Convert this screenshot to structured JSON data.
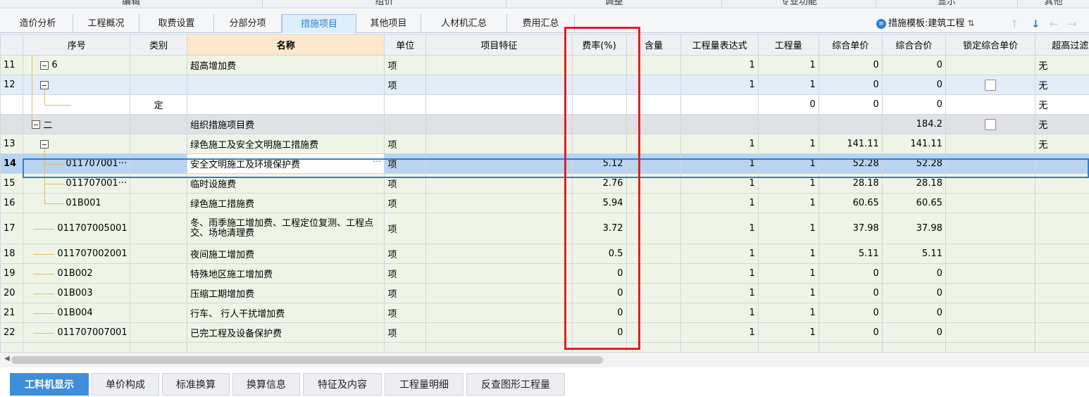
{
  "groups": [
    "编辑",
    "组价",
    "调整",
    "专业功能",
    "显示",
    "其他"
  ],
  "tabs": [
    {
      "label": "造价分析"
    },
    {
      "label": "工程概况"
    },
    {
      "label": "取费设置"
    },
    {
      "label": "分部分项"
    },
    {
      "label": "措施项目",
      "active": true
    },
    {
      "label": "其他项目"
    },
    {
      "label": "人材机汇总"
    },
    {
      "label": "费用汇总"
    }
  ],
  "template": {
    "label": "措施模板:建筑工程",
    "icon": "list-icon",
    "sort_icon": "sort-icon"
  },
  "nav_arrows": {
    "up": "↑",
    "down": "↓",
    "left": "←",
    "right": "→"
  },
  "columns": [
    "序号",
    "类别",
    "名称",
    "单位",
    "项目特征",
    "费率(%)",
    "含量",
    "工程量表达式",
    "工程量",
    "综合单价",
    "综合合价",
    "锁定综合单价",
    "超高过滤类别"
  ],
  "rows": [
    {
      "rn": "11",
      "code": "6",
      "type": "",
      "name": "超高增加费",
      "unit": "项",
      "feature": "",
      "rate": "",
      "content": "",
      "expr": "1",
      "qty": "1",
      "price": "0",
      "total": "0",
      "lock": false,
      "filter": "无"
    },
    {
      "rn": "12",
      "code": "",
      "type": "",
      "name": "",
      "unit": "项",
      "feature": "",
      "rate": "",
      "content": "",
      "expr": "1",
      "qty": "1",
      "price": "0",
      "total": "0",
      "lock": true,
      "filter": "无"
    },
    {
      "rn": "",
      "code": "",
      "type": "定",
      "name": "",
      "unit": "",
      "feature": "",
      "rate": "",
      "content": "",
      "expr": "",
      "qty": "0",
      "price": "0",
      "total": "0",
      "lock": false,
      "filter": "无"
    },
    {
      "rn": "",
      "code": "二",
      "type": "",
      "name": "组织措施项目费",
      "unit": "",
      "feature": "",
      "rate": "",
      "content": "",
      "expr": "",
      "qty": "",
      "price": "",
      "total": "184.2",
      "lock": true,
      "filter": "无"
    },
    {
      "rn": "13",
      "code": "",
      "type": "",
      "name": "绿色施工及安全文明施工措施费",
      "unit": "项",
      "feature": "",
      "rate": "",
      "content": "",
      "expr": "1",
      "qty": "1",
      "price": "141.11",
      "total": "141.11",
      "lock": false,
      "filter": "无"
    },
    {
      "rn": "14",
      "code": "011707001···",
      "type": "",
      "name": "安全文明施工及环境保护费",
      "name_dots": "···",
      "unit": "项",
      "feature": "",
      "rate": "5.12",
      "content": "",
      "expr": "1",
      "qty": "1",
      "price": "52.28",
      "total": "52.28",
      "lock": false,
      "filter": ""
    },
    {
      "rn": "15",
      "code": "011707001···",
      "type": "",
      "name": "临时设施费",
      "unit": "项",
      "feature": "",
      "rate": "2.76",
      "content": "",
      "expr": "1",
      "qty": "1",
      "price": "28.18",
      "total": "28.18",
      "lock": false,
      "filter": ""
    },
    {
      "rn": "16",
      "code": "01B001",
      "type": "",
      "name": "绿色施工措施费",
      "unit": "项",
      "feature": "",
      "rate": "5.94",
      "content": "",
      "expr": "1",
      "qty": "1",
      "price": "60.65",
      "total": "60.65",
      "lock": false,
      "filter": ""
    },
    {
      "rn": "17",
      "code": "011707005001",
      "type": "",
      "name": "冬、雨季施工增加费、工程定位复测、工程点交、场地清理费",
      "unit": "项",
      "feature": "",
      "rate": "3.72",
      "content": "",
      "expr": "1",
      "qty": "1",
      "price": "37.98",
      "total": "37.98",
      "lock": false,
      "filter": ""
    },
    {
      "rn": "18",
      "code": "011707002001",
      "type": "",
      "name": "夜间施工增加费",
      "unit": "项",
      "feature": "",
      "rate": "0.5",
      "content": "",
      "expr": "1",
      "qty": "1",
      "price": "5.11",
      "total": "5.11",
      "lock": false,
      "filter": ""
    },
    {
      "rn": "19",
      "code": "01B002",
      "type": "",
      "name": "特殊地区施工增加费",
      "unit": "项",
      "feature": "",
      "rate": "0",
      "content": "",
      "expr": "1",
      "qty": "1",
      "price": "0",
      "total": "0",
      "lock": false,
      "filter": ""
    },
    {
      "rn": "20",
      "code": "01B003",
      "type": "",
      "name": "压缩工期增加费",
      "unit": "项",
      "feature": "",
      "rate": "0",
      "content": "",
      "expr": "1",
      "qty": "1",
      "price": "0",
      "total": "0",
      "lock": false,
      "filter": ""
    },
    {
      "rn": "21",
      "code": "01B004",
      "type": "",
      "name": "行车、 行人干扰增加费",
      "unit": "项",
      "feature": "",
      "rate": "0",
      "content": "",
      "expr": "1",
      "qty": "1",
      "price": "0",
      "total": "0",
      "lock": false,
      "filter": ""
    },
    {
      "rn": "22",
      "code": "011707007001",
      "type": "",
      "name": "已完工程及设备保护费",
      "unit": "项",
      "feature": "",
      "rate": "0",
      "content": "",
      "expr": "1",
      "qty": "1",
      "price": "0",
      "total": "0",
      "lock": false,
      "filter": ""
    }
  ],
  "bottom_tabs": [
    {
      "label": "工料机显示",
      "active": true
    },
    {
      "label": "单价构成"
    },
    {
      "label": "标准换算"
    },
    {
      "label": "换算信息"
    },
    {
      "label": "特征及内容"
    },
    {
      "label": "工程量明细"
    },
    {
      "label": "反查图形工程量"
    }
  ],
  "colors": {
    "accent": "#2f7fd3",
    "highlight_box": "#e31e24",
    "selected_row": "#b9d4f0",
    "tree_line": "#e1b86f"
  }
}
